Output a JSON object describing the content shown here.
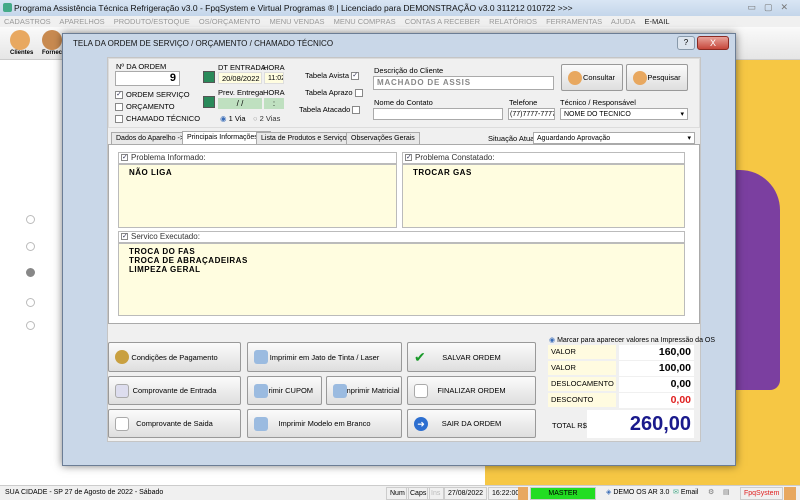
{
  "app": {
    "title": "Programa Assistência Técnica Refrigeração v3.0 - FpqSystem e Virtual Programas ® | Licenciado para  DEMONSTRAÇÃO v3.0 311212 010722 >>>"
  },
  "menu": [
    "CADASTROS",
    "APARELHOS",
    "PRODUTO/ESTOQUE",
    "OS/ORÇAMENTO",
    "MENU VENDAS",
    "MENU COMPRAS",
    "CONTAS A RECEBER",
    "RELATÓRIOS",
    "FERRAMENTAS",
    "AJUDA",
    "E-MAIL"
  ],
  "toolbar": {
    "clientes": "Clientes",
    "fornecedores": "Fornece"
  },
  "dialog": {
    "title": "TELA DA ORDEM DE SERVIÇO / ORÇAMENTO / CHAMADO TÉCNICO",
    "close": "X",
    "help": "?",
    "order_label": "Nº DA ORDEM",
    "order_number": "9",
    "type_options": [
      {
        "label": "ORDEM SERVIÇO",
        "checked": true
      },
      {
        "label": "ORÇAMENTO",
        "checked": false
      },
      {
        "label": "CHAMADO TÉCNICO",
        "checked": false
      }
    ],
    "dt_entrada_label": "DT ENTRADA",
    "hora_label": "HORA",
    "dt_entrada": "20/08/2022",
    "hora": "11:02",
    "prev_entrega_label": "Prev. Entrega",
    "hora2_label": "HORA",
    "prev_entrega": "/ /",
    "hora2": ":",
    "vias": [
      {
        "label": "1 Via",
        "selected": true
      },
      {
        "label": "2 Vias",
        "selected": false
      }
    ],
    "tabelas": [
      {
        "label": "Tabela Avista",
        "checked": true
      },
      {
        "label": "Tabela Aprazo",
        "checked": false
      },
      {
        "label": "Tabela Atacado",
        "checked": false
      }
    ],
    "cliente_label": "Descrição do Cliente",
    "cliente": "MACHADO DE ASSIS",
    "consultar": "Consultar",
    "pesquisar": "Pesquisar",
    "contato_label": "Nome do Contato",
    "contato": "",
    "telefone_label": "Telefone",
    "telefone": "(77)7777-7777",
    "tecnico_label": "Técnico / Responsável",
    "tecnico": "NOME DO TECNICO",
    "tabs": [
      "Dados do Aparelho ->",
      "Principais Informações ->",
      "Lista de Produtos e Serviços ->",
      "Observações Gerais"
    ],
    "situacao_label": "Situação Atual:",
    "situacao": "Aguardando Aprovação",
    "problema_informado_label": "Problema Informado:",
    "problema_informado": "NÃO LIGA",
    "problema_constatado_label": "Problema Constatado:",
    "problema_constatado": "TROCAR GAS",
    "servico_label": "Servico Executado:",
    "servico": "TROCA DO FAS\nTROCA DE ABRAÇADEIRAS\nLIMPEZA GERAL",
    "buttons": {
      "pagamento": "Condições de Pagamento",
      "jato": "Imprimir em Jato de Tinta / Laser",
      "salvar": "SALVAR ORDEM",
      "entrada": "Comprovante de Entrada",
      "cupom": "Imprimir CUPOM",
      "matricial": "Imprimir Matricial",
      "finalizar": "FINALIZAR ORDEM",
      "saida": "Comprovante de Saida",
      "branco": "Imprimir Modelo em Branco",
      "sair": "SAIR DA ORDEM"
    },
    "marcar_label": "Marcar para aparecer valores na Impressão da OS",
    "values": [
      {
        "label": "VALOR PRODUTOS",
        "value": "160,00"
      },
      {
        "label": "VALOR SERVICOS",
        "value": "100,00"
      },
      {
        "label": "DESLOCAMENTO",
        "value": "0,00"
      },
      {
        "label": "DESCONTO",
        "value": "0,00"
      }
    ],
    "total_label": "TOTAL R$",
    "total": "260,00"
  },
  "status": {
    "city": "SUA CIDADE - SP 27 de Agosto de 2022 - Sábado",
    "num": "Num",
    "caps": "Caps",
    "ins": "Ins",
    "date": "27/08/2022",
    "time": "16:22:00",
    "user": "MASTER",
    "db": "DEMO OS AR 3.0",
    "email": "Email",
    "brand": "FpqSystem"
  },
  "colors": {
    "total": "#1a1a8c",
    "desconto": "#e02020",
    "master": "#22dd22"
  }
}
